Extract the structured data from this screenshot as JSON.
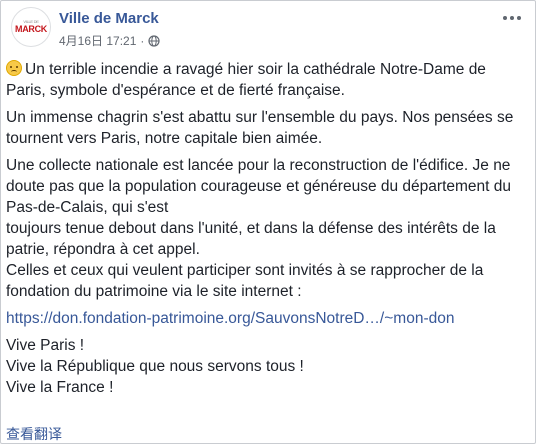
{
  "header": {
    "avatar_logo_small": "VILLE DE",
    "avatar_logo": "MARCK",
    "page_name": "Ville de Marck",
    "timestamp": "4月16日 17:21",
    "separator": "·",
    "privacy_icon": "globe-icon",
    "more_icon": "more-options-icon"
  },
  "post": {
    "p1": "Un terrible incendie a ravagé hier soir la cathédrale Notre-Dame de Paris, symbole d'espérance et de fierté française.",
    "p2": "Un immense chagrin s'est abattu sur l'ensemble du pays. Nos pensées se tournent vers Paris, notre capitale bien aimée.",
    "p3_l1": "Une collecte nationale est lancée pour la reconstruction de l'édifice. Je ne doute pas que la population courageuse et généreuse du département du Pas-de-Calais, qui s'est",
    "p3_l2": "toujours tenue debout dans l'unité, et dans la défense des intérêts de la patrie, répondra à cet appel.",
    "p3_l3": "Celles et ceux qui veulent participer sont invités à se rapprocher de la fondation du patrimoine via le site internet :",
    "link": "https://don.fondation-patrimoine.org/SauvonsNotreD…/~mon-don",
    "closing_1": "Vive Paris !",
    "closing_2": "Vive la République que nous servons tous !",
    "closing_3": "Vive la France !"
  },
  "footer": {
    "translate_label": "查看翻译"
  },
  "colors": {
    "link": "#385898",
    "meta": "#616770",
    "text": "#1d2129"
  }
}
